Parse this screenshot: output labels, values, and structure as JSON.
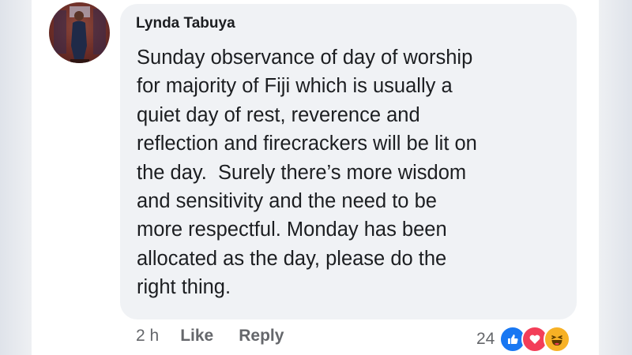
{
  "comment": {
    "author": "Lynda Tabuya",
    "text": "Sunday observance of day of worship\nfor majority of Fiji which is usually a\nquiet day of rest, reverence and\nreflection and firecrackers will be lit on\nthe day.  Surely there’s more wisdom\nand sensitivity and the need to be\nmore respectful. Monday has been\nallocated as the day, please do the\nright thing.",
    "time": "2 h",
    "like_label": "Like",
    "reply_label": "Reply",
    "reaction_count": "24",
    "reactions": [
      "like-icon",
      "love-icon",
      "haha-icon"
    ]
  },
  "colors": {
    "bubble": "#f0f2f5",
    "text": "#1c1e21",
    "meta": "#65676b",
    "like_blue": "#1877f2",
    "love_red": "#f33e58",
    "haha_yellow": "#f7b125"
  }
}
